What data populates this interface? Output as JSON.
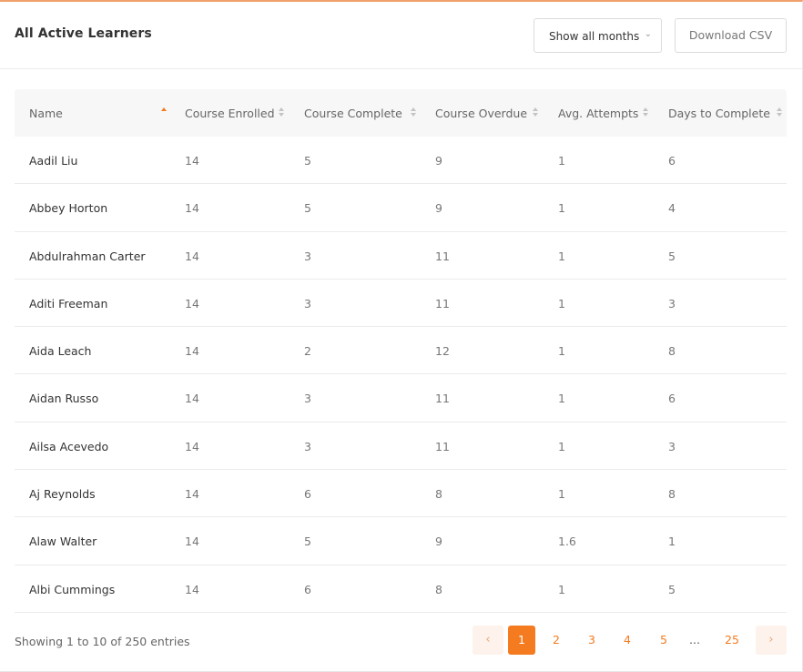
{
  "header": {
    "title": "All Active Learners",
    "month_filter": "Show all months",
    "download_label": "Download CSV"
  },
  "table": {
    "columns": [
      "Name",
      "Course Enrolled",
      "Course Complete",
      "Course Overdue",
      "Avg. Attempts",
      "Days to Complete"
    ],
    "rows": [
      [
        "Aadil Liu",
        "14",
        "5",
        "9",
        "1",
        "6"
      ],
      [
        "Abbey Horton",
        "14",
        "5",
        "9",
        "1",
        "4"
      ],
      [
        "Abdulrahman Carter",
        "14",
        "3",
        "11",
        "1",
        "5"
      ],
      [
        "Aditi Freeman",
        "14",
        "3",
        "11",
        "1",
        "3"
      ],
      [
        "Aida Leach",
        "14",
        "2",
        "12",
        "1",
        "8"
      ],
      [
        "Aidan Russo",
        "14",
        "3",
        "11",
        "1",
        "6"
      ],
      [
        "Ailsa Acevedo",
        "14",
        "3",
        "11",
        "1",
        "3"
      ],
      [
        "Aj Reynolds",
        "14",
        "6",
        "8",
        "1",
        "8"
      ],
      [
        "Alaw Walter",
        "14",
        "5",
        "9",
        "1.6",
        "1"
      ],
      [
        "Albi Cummings",
        "14",
        "6",
        "8",
        "1",
        "5"
      ]
    ],
    "sort_column": "Name",
    "sort_direction": "ascending"
  },
  "footer": {
    "info": "Showing 1 to 10 of 250 entries",
    "pages": [
      "1",
      "2",
      "3",
      "4",
      "5"
    ],
    "ellipsis": "...",
    "last_page": "25",
    "current_page": "1",
    "prev_icon": "chevron-left-icon",
    "next_icon": "chevron-right-icon"
  },
  "colors": {
    "accent": "#f47b20",
    "accent_light": "#fdf3ec",
    "top_border": "#f0a06a"
  }
}
